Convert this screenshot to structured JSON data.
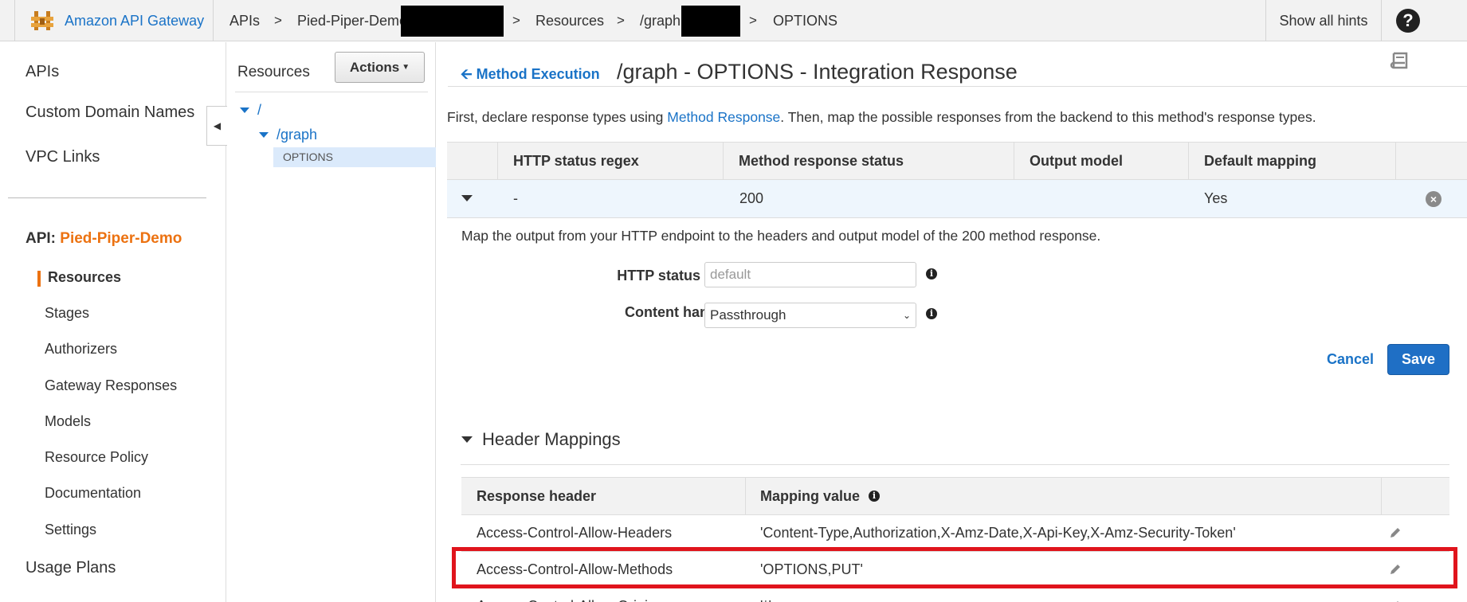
{
  "topbar": {
    "brand": "Amazon API Gateway",
    "breadcrumbs": [
      "APIs",
      "Pied-Piper-Demo",
      "Resources",
      "/graph",
      "OPTIONS"
    ],
    "separator": ">",
    "show_hints": "Show all hints",
    "help_icon": "?"
  },
  "leftnav": {
    "top_items": [
      "APIs",
      "Custom Domain Names",
      "VPC Links"
    ],
    "api_prefix": "API:",
    "api_name": "Pied-Piper-Demo",
    "sub_items": [
      "Resources",
      "Stages",
      "Authorizers",
      "Gateway Responses",
      "Models",
      "Resource Policy",
      "Documentation",
      "Settings"
    ],
    "usage_plans": "Usage Plans"
  },
  "resources": {
    "title": "Resources",
    "actions": "Actions",
    "tree": [
      "/",
      "/graph",
      "OPTIONS"
    ]
  },
  "main": {
    "back_link": "Method Execution",
    "title": "/graph - OPTIONS - Integration Response",
    "intro_before": "First, declare response types using ",
    "intro_link": "Method Response",
    "intro_after": ". Then, map the possible responses from the backend to this method's response types.",
    "table": {
      "headers": [
        "HTTP status regex",
        "Method response status",
        "Output model",
        "Default mapping"
      ],
      "row": {
        "regex": "-",
        "status": "200",
        "model": "",
        "default": "Yes"
      }
    },
    "description": "Map the output from your HTTP endpoint to the headers and output model of the 200 method response.",
    "form": {
      "regex_label": "HTTP status regex",
      "regex_placeholder": "default",
      "content_label": "Content handling",
      "content_value": "Passthrough"
    },
    "cancel": "Cancel",
    "save": "Save",
    "header_mappings": {
      "title": "Header Mappings",
      "columns": [
        "Response header",
        "Mapping value"
      ],
      "rows": [
        {
          "header": "Access-Control-Allow-Headers",
          "value": "'Content-Type,Authorization,X-Amz-Date,X-Api-Key,X-Amz-Security-Token'"
        },
        {
          "header": "Access-Control-Allow-Methods",
          "value": "'OPTIONS,PUT'"
        },
        {
          "header": "Access-Control-Allow-Origin",
          "value": "'*'"
        }
      ]
    }
  },
  "colors": {
    "accent_orange": "#ec7211",
    "link_blue": "#1a73c7",
    "highlight_red": "#e0141c",
    "save_blue": "#1f6fc5"
  },
  "icons": [
    "api-gateway-logo-icon",
    "help-icon",
    "collapse-icon",
    "tree-caret-icon",
    "back-arrow-icon",
    "book-icon",
    "caret-down-icon",
    "close-circle-icon",
    "info-icon",
    "pencil-icon",
    "dropdown-chevron-icon"
  ]
}
